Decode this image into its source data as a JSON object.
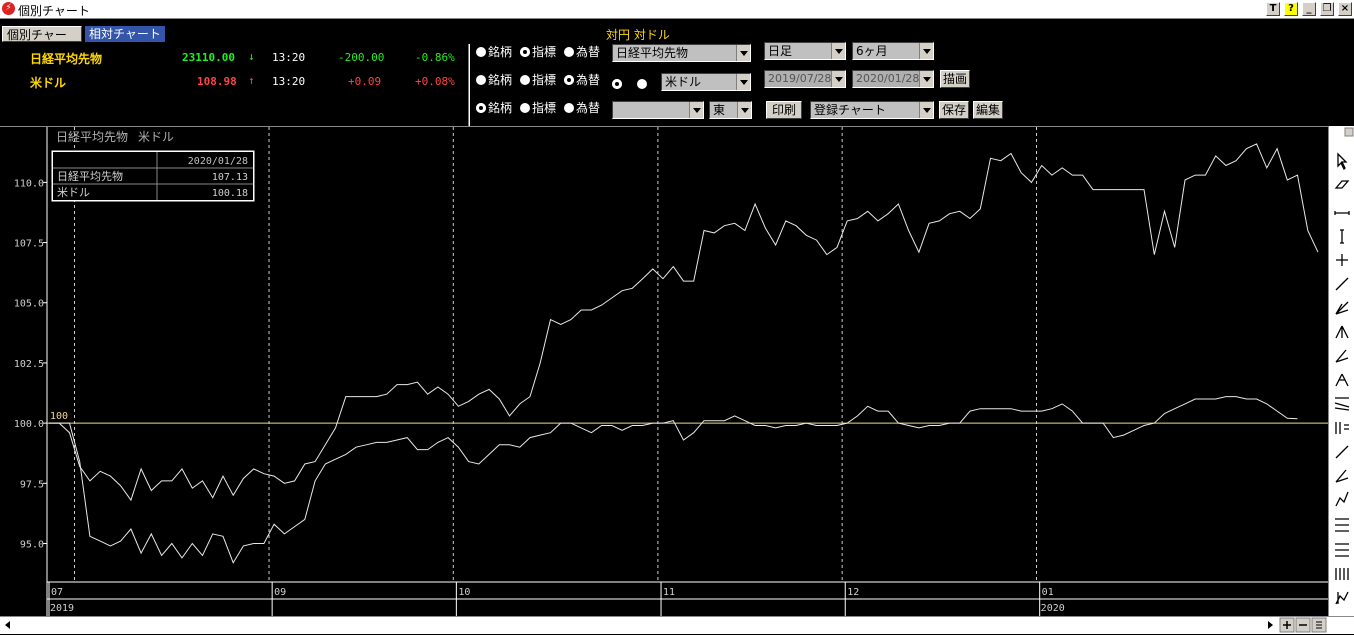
{
  "window": {
    "title": "個別チャート"
  },
  "tabs": [
    {
      "label": "個別チャート"
    },
    {
      "label": "相対チャート"
    }
  ],
  "quotes": [
    {
      "name": "日経平均先物",
      "price": "23110.00",
      "arrow": "↓",
      "time": "13:20",
      "change": "-200.00",
      "pct": "-0.86%",
      "price_color": "#22ee22",
      "arrow_color": "#22ee22",
      "change_color": "#22ee22"
    },
    {
      "name": "米ドル",
      "price": "108.98",
      "arrow": "↑",
      "time": "13:20",
      "change": "+0.09",
      "pct": "+0.08%",
      "price_color": "#ff4444",
      "arrow_color": "#ff4444",
      "change_color": "#ff4444"
    }
  ],
  "controls": {
    "header": "対円 対ドル",
    "radio_labels": [
      "銘柄",
      "指標",
      "為替"
    ],
    "rows": [
      {
        "selected": 1,
        "combo": "日経平均先物"
      },
      {
        "selected": 2,
        "combo": "米ドル"
      },
      {
        "selected": 0,
        "combo": "",
        "market": "東"
      }
    ],
    "period": "日足",
    "range": "6ヶ月",
    "date_from": "2019/07/28",
    "date_to": "2020/01/28",
    "draw_button": "描画",
    "print_button": "印刷",
    "saved_chart": "登録チャート",
    "save_button": "保存",
    "edit_button": "編集"
  },
  "legend": {
    "series1": "日経平均先物",
    "series2": "米ドル"
  },
  "infobox": {
    "date": "2020/01/28",
    "rows": [
      {
        "name": "日経平均先物",
        "value": "107.13"
      },
      {
        "name": "米ドル",
        "value": "100.18"
      }
    ]
  },
  "chart_data": {
    "type": "line",
    "ylabels": [
      "110.0",
      "107.5",
      "105.0",
      "102.5",
      "100.0",
      "97.5",
      "95.0"
    ],
    "yticks": [
      110,
      107.5,
      105,
      102.5,
      100,
      97.5,
      95
    ],
    "ylim": [
      93.4,
      112.3
    ],
    "baseline_label": "100",
    "baseline": 100,
    "xticks": [
      {
        "label": "07",
        "year": "2019",
        "index": 0
      },
      {
        "label": "09",
        "year": "",
        "index": 22
      },
      {
        "label": "10",
        "year": "",
        "index": 40
      },
      {
        "label": "11",
        "year": "",
        "index": 60
      },
      {
        "label": "12",
        "year": "",
        "index": 78
      },
      {
        "label": "01",
        "year": "2020",
        "index": 97
      }
    ],
    "vlines": [
      2.5,
      21.5,
      39.5,
      59.5,
      77.5,
      96.5
    ],
    "colors": {
      "axis": "#ffffff",
      "grid": "#ffffff",
      "baseline": "#f0d890",
      "series1": "#e8e8e8",
      "series2": "#e8e8e8"
    },
    "series": [
      {
        "name": "日経平均先物",
        "values": [
          100.0,
          100.0,
          99.6,
          98.2,
          97.6,
          98.0,
          97.8,
          97.4,
          96.8,
          98.1,
          97.2,
          97.6,
          97.6,
          98.1,
          97.3,
          97.6,
          96.9,
          97.8,
          97.0,
          97.7,
          98.1,
          97.9,
          97.8,
          97.5,
          97.6,
          98.3,
          98.4,
          99.1,
          99.8,
          101.1,
          101.1,
          101.1,
          101.1,
          101.2,
          101.6,
          101.6,
          101.7,
          101.2,
          101.5,
          101.2,
          100.7,
          100.9,
          101.2,
          101.4,
          101.0,
          100.3,
          100.8,
          101.1,
          102.5,
          104.3,
          104.1,
          104.3,
          104.7,
          104.7,
          104.9,
          105.2,
          105.5,
          105.6,
          106.0,
          106.4,
          106.0,
          106.5,
          105.9,
          105.9,
          108.0,
          107.9,
          108.2,
          108.3,
          108.0,
          109.1,
          108.1,
          107.4,
          108.4,
          108.2,
          107.8,
          107.6,
          107.0,
          107.3,
          108.4,
          108.5,
          108.8,
          108.4,
          108.7,
          109.1,
          108.0,
          107.1,
          108.3,
          108.4,
          108.7,
          108.8,
          108.5,
          108.9,
          111.0,
          110.9,
          111.2,
          110.4,
          110.0,
          110.7,
          110.3,
          110.6,
          110.3,
          110.3,
          109.7,
          109.7,
          109.7,
          109.7,
          109.7,
          109.7,
          107.0,
          108.8,
          107.3,
          110.1,
          110.3,
          110.3,
          111.1,
          110.7,
          110.9,
          111.4,
          111.6,
          110.6,
          111.4,
          110.1,
          110.3,
          108.0,
          107.1
        ]
      },
      {
        "name": "米ドル",
        "values": [
          100.0,
          100.0,
          100.0,
          98.4,
          95.3,
          95.1,
          94.9,
          95.1,
          95.6,
          94.6,
          95.4,
          94.5,
          95.0,
          94.4,
          95.0,
          94.5,
          95.4,
          95.3,
          94.2,
          94.9,
          95.0,
          95.0,
          95.8,
          95.4,
          95.7,
          96.0,
          97.6,
          98.3,
          98.5,
          98.7,
          99.0,
          99.1,
          99.2,
          99.2,
          99.3,
          99.4,
          98.9,
          98.9,
          99.2,
          99.4,
          99.0,
          98.4,
          98.3,
          98.7,
          99.1,
          99.1,
          99.0,
          99.4,
          99.5,
          99.6,
          100.0,
          100.0,
          99.8,
          99.6,
          99.9,
          99.9,
          99.7,
          99.9,
          99.9,
          100.0,
          100.0,
          100.1,
          99.3,
          99.6,
          100.1,
          100.1,
          100.1,
          100.3,
          100.1,
          99.9,
          99.9,
          99.8,
          99.9,
          99.9,
          100.0,
          99.9,
          99.9,
          99.9,
          100.0,
          100.3,
          100.7,
          100.5,
          100.5,
          100.0,
          99.9,
          99.8,
          99.9,
          99.9,
          100.0,
          100.0,
          100.5,
          100.6,
          100.6,
          100.6,
          100.6,
          100.5,
          100.5,
          100.5,
          100.6,
          100.8,
          100.5,
          100.0,
          100.0,
          100.0,
          99.4,
          99.5,
          99.7,
          99.9,
          100.0,
          100.4,
          100.6,
          100.8,
          101.0,
          101.0,
          101.0,
          101.1,
          101.1,
          101.0,
          101.0,
          100.8,
          100.5,
          100.2,
          100.18
        ]
      }
    ]
  }
}
